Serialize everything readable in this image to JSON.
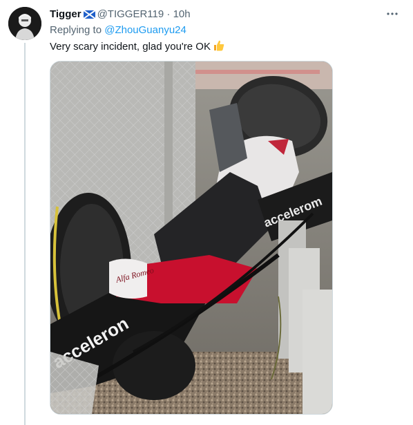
{
  "tweet": {
    "author_name": "Tigger",
    "author_flag": "scotland-flag-icon",
    "author_handle": "@TIGGER119",
    "separator": "·",
    "timestamp": "10h",
    "replying_prefix": "Replying to",
    "replying_mention": "@ZhouGuanyu24",
    "text": "Very scary incident, glad you're OK",
    "emoji": "thumbs-up-icon",
    "more_label": "···"
  },
  "media": {
    "image_subject": "crashed-race-car-photo",
    "car_text_side": "acceleron",
    "car_text_top": "accelerom",
    "sponsor_text": "Alfa Romeo"
  },
  "colors": {
    "link": "#1d9bf0",
    "secondary_text": "#536471",
    "thread_line": "#cfd9de"
  }
}
